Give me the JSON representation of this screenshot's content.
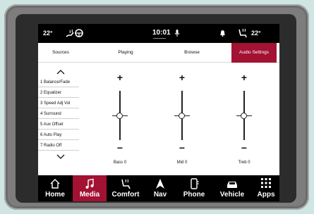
{
  "status_bar": {
    "left_temp": "22°",
    "time": "10:01",
    "right_temp": "22°"
  },
  "tabs": [
    {
      "label": "Sources",
      "active": false
    },
    {
      "label": "Playing",
      "active": false
    },
    {
      "label": "Browse",
      "active": false
    },
    {
      "label": "Audio Settings",
      "active": true
    }
  ],
  "audio_menu": {
    "up_icon": "chevron-up-icon",
    "down_icon": "chevron-down-icon",
    "items": [
      "1 Balance/Fade",
      "2 Equalizer",
      "3 Speed Adj Vol",
      "4 Surround",
      "5 Aux Offset",
      "6 Auto Play",
      "7 Radio Off"
    ]
  },
  "equalizer": {
    "bands": [
      {
        "label": "Bass 0",
        "value": 0
      },
      {
        "label": "Mid 0",
        "value": 0
      },
      {
        "label": "Treb 0",
        "value": 0
      }
    ],
    "plus": "+",
    "minus": "−"
  },
  "nav": {
    "items": [
      {
        "label": "Home",
        "icon": "home-icon",
        "active": false
      },
      {
        "label": "Media",
        "icon": "music-note-icon",
        "active": true
      },
      {
        "label": "Comfort",
        "icon": "seat-icon",
        "active": false
      },
      {
        "label": "Nav",
        "icon": "navigation-arrow-icon",
        "active": false
      },
      {
        "label": "Phone",
        "icon": "phone-icon",
        "active": false
      },
      {
        "label": "Vehicle",
        "icon": "car-icon",
        "active": false
      },
      {
        "label": "Apps",
        "icon": "apps-grid-icon",
        "active": false
      }
    ]
  },
  "colors": {
    "accent": "#a31133",
    "bar_bg": "#000000",
    "bezel": "#7d7d7d"
  }
}
